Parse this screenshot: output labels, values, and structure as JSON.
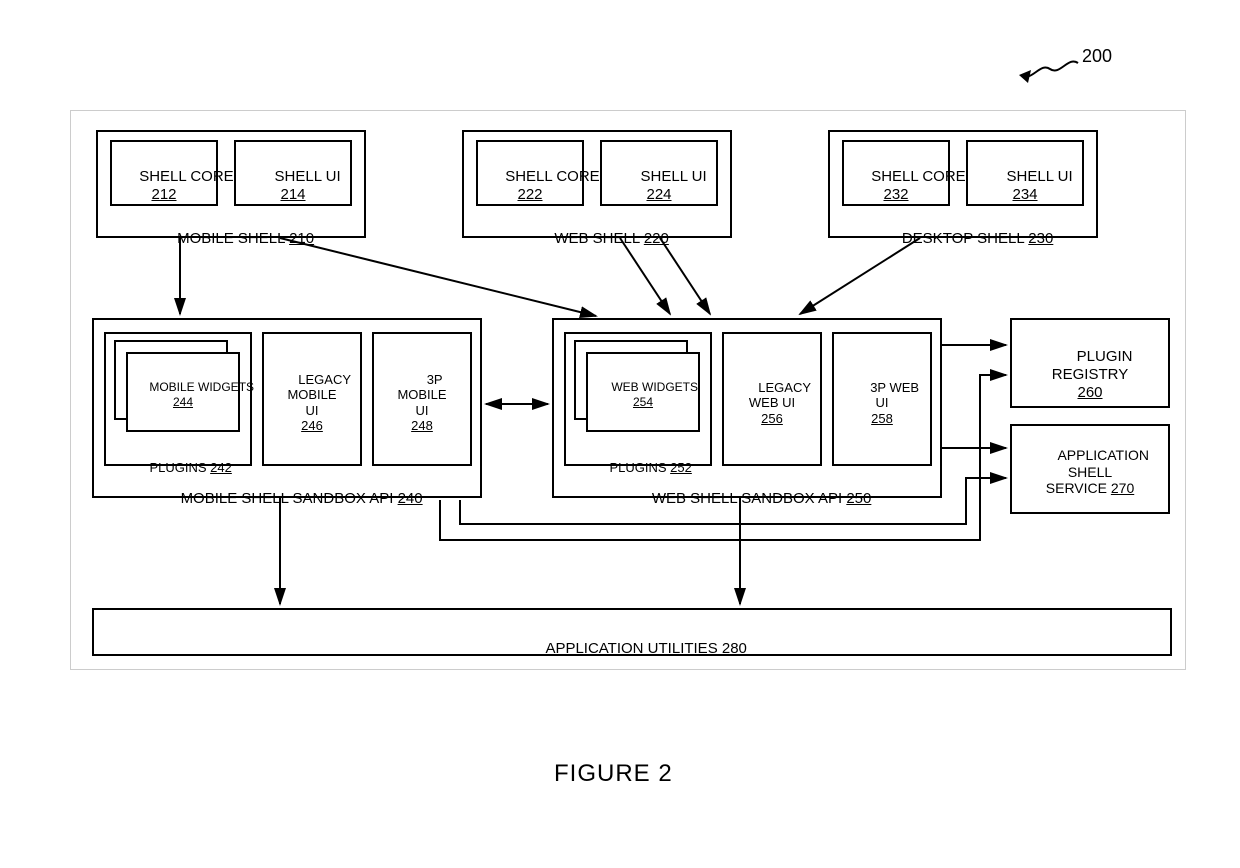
{
  "figure_ref": "200",
  "figure_title": "FIGURE 2",
  "shells": {
    "mobile": {
      "label": "MOBILE SHELL",
      "ref": "210",
      "core": {
        "label": "SHELL CORE",
        "ref": "212"
      },
      "ui": {
        "label": "SHELL UI",
        "ref": "214"
      }
    },
    "web": {
      "label": "WEB SHELL",
      "ref": "220",
      "core": {
        "label": "SHELL CORE",
        "ref": "222"
      },
      "ui": {
        "label": "SHELL UI",
        "ref": "224"
      }
    },
    "desktop": {
      "label": "DESKTOP SHELL",
      "ref": "230",
      "core": {
        "label": "SHELL CORE",
        "ref": "232"
      },
      "ui": {
        "label": "SHELL UI",
        "ref": "234"
      }
    }
  },
  "sandbox": {
    "mobile": {
      "label": "MOBILE SHELL SANDBOX API",
      "ref": "240",
      "plugins": {
        "label": "PLUGINS",
        "ref": "242",
        "widgets": {
          "label": "MOBILE WIDGETS",
          "ref": "244"
        }
      },
      "legacy": {
        "line1": "LEGACY",
        "line2": "MOBILE",
        "line3": "UI",
        "ref": "246"
      },
      "tp": {
        "line1": "3P",
        "line2": "MOBILE",
        "line3": "UI",
        "ref": "248"
      }
    },
    "web": {
      "label": "WEB SHELL SANDBOX API",
      "ref": "250",
      "plugins": {
        "label": "PLUGINS",
        "ref": "252",
        "widgets": {
          "label": "WEB WIDGETS",
          "ref": "254"
        }
      },
      "legacy": {
        "line1": "LEGACY",
        "line2": "WEB UI",
        "ref": "256"
      },
      "tp": {
        "line1": "3P WEB",
        "line2": "UI",
        "ref": "258"
      }
    }
  },
  "right": {
    "registry": {
      "line1": "PLUGIN",
      "line2": "REGISTRY",
      "ref": "260"
    },
    "appshell": {
      "line1": "APPLICATION",
      "line2": "SHELL",
      "line3": "SERVICE",
      "ref": "270"
    }
  },
  "utilities": {
    "label": "APPLICATION UTILITIES",
    "ref": "280"
  }
}
